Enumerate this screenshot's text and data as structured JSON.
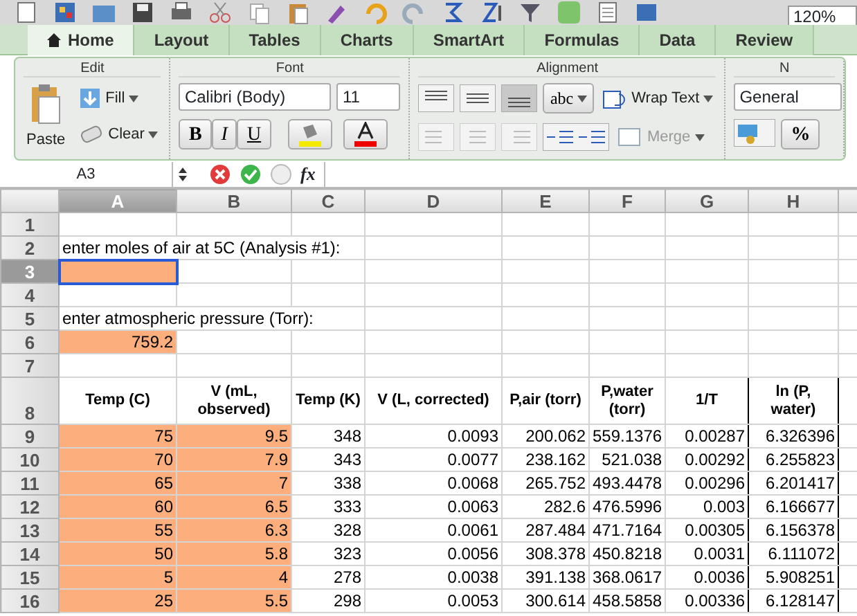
{
  "toolbar": {
    "zoom": "120%"
  },
  "tabs": [
    {
      "label": "Home",
      "selected": true
    },
    {
      "label": "Layout",
      "selected": false
    },
    {
      "label": "Tables",
      "selected": false
    },
    {
      "label": "Charts",
      "selected": false
    },
    {
      "label": "SmartArt",
      "selected": false
    },
    {
      "label": "Formulas",
      "selected": false
    },
    {
      "label": "Data",
      "selected": false
    },
    {
      "label": "Review",
      "selected": false
    }
  ],
  "ribbon": {
    "edit": {
      "title": "Edit",
      "paste": "Paste",
      "fill": "Fill",
      "clear": "Clear"
    },
    "font": {
      "title": "Font",
      "name": "Calibri (Body)",
      "size": "11",
      "bold": "B",
      "italic": "I",
      "underline": "U"
    },
    "alignment": {
      "title": "Alignment",
      "orientation": "abc",
      "wrap": "Wrap Text",
      "merge": "Merge",
      "merge_disabled": true
    },
    "number": {
      "title": "N",
      "format": "General",
      "percent": "%"
    }
  },
  "formula_bar": {
    "name_box": "A3",
    "fx": "fx"
  },
  "columns": [
    {
      "label": "A",
      "selected": true
    },
    {
      "label": "B",
      "selected": false
    },
    {
      "label": "C",
      "selected": false
    },
    {
      "label": "D",
      "selected": false
    },
    {
      "label": "E",
      "selected": false
    },
    {
      "label": "F",
      "selected": false
    },
    {
      "label": "G",
      "selected": false
    },
    {
      "label": "H",
      "selected": false
    }
  ],
  "rows": [
    {
      "number": "1",
      "selected": false,
      "cells": [
        {},
        {},
        {},
        {},
        {},
        {},
        {},
        {}
      ]
    },
    {
      "number": "2",
      "selected": false,
      "cells": [
        {
          "kind": "label",
          "text": "enter moles of air at 5C (Analysis #1):"
        },
        {},
        {},
        {},
        {},
        {},
        {},
        {}
      ]
    },
    {
      "number": "3",
      "selected": true,
      "cells": [
        {
          "input": true,
          "active": true
        },
        {},
        {},
        {},
        {},
        {},
        {},
        {}
      ]
    },
    {
      "number": "4",
      "selected": false,
      "cells": [
        {},
        {},
        {},
        {},
        {},
        {},
        {},
        {}
      ]
    },
    {
      "number": "5",
      "selected": false,
      "cells": [
        {
          "kind": "label",
          "text": "enter atmospheric pressure (Torr):"
        },
        {},
        {},
        {},
        {},
        {},
        {},
        {}
      ]
    },
    {
      "number": "6",
      "selected": false,
      "cells": [
        {
          "kind": "number",
          "text": "759.2",
          "input": true
        },
        {},
        {},
        {},
        {},
        {},
        {},
        {}
      ]
    },
    {
      "number": "7",
      "selected": false,
      "cells": [
        {},
        {},
        {},
        {},
        {},
        {},
        {},
        {}
      ]
    },
    {
      "number": "8",
      "selected": false,
      "cells": [
        {
          "kind": "header",
          "text": "Temp (C)"
        },
        {
          "kind": "header",
          "text": "V (mL, observed)"
        },
        {
          "kind": "header",
          "text": "Temp (K)"
        },
        {
          "kind": "header",
          "text": "V (L, corrected)"
        },
        {
          "kind": "header",
          "text": "P,air (torr)"
        },
        {
          "kind": "header",
          "text": "P,water (torr)"
        },
        {
          "kind": "header",
          "text": "1/T",
          "bordered": true
        },
        {
          "kind": "header",
          "text": "ln (P, water)",
          "bordered": true
        }
      ]
    },
    {
      "number": "9",
      "selected": false,
      "cells": [
        {
          "kind": "number",
          "text": "75",
          "input": true
        },
        {
          "kind": "number",
          "text": "9.5",
          "input": true
        },
        {
          "kind": "number",
          "text": "348"
        },
        {
          "kind": "number",
          "text": "0.0093"
        },
        {
          "kind": "number",
          "text": "200.062"
        },
        {
          "kind": "number",
          "text": "559.1376"
        },
        {
          "kind": "number",
          "text": "0.00287",
          "bordered": true
        },
        {
          "kind": "number",
          "text": "6.326396",
          "bordered": true
        }
      ]
    },
    {
      "number": "10",
      "selected": false,
      "cells": [
        {
          "kind": "number",
          "text": "70",
          "input": true
        },
        {
          "kind": "number",
          "text": "7.9",
          "input": true
        },
        {
          "kind": "number",
          "text": "343"
        },
        {
          "kind": "number",
          "text": "0.0077"
        },
        {
          "kind": "number",
          "text": "238.162"
        },
        {
          "kind": "number",
          "text": "521.038"
        },
        {
          "kind": "number",
          "text": "0.00292",
          "bordered": true
        },
        {
          "kind": "number",
          "text": "6.255823",
          "bordered": true
        }
      ]
    },
    {
      "number": "11",
      "selected": false,
      "cells": [
        {
          "kind": "number",
          "text": "65",
          "input": true
        },
        {
          "kind": "number",
          "text": "7",
          "input": true
        },
        {
          "kind": "number",
          "text": "338"
        },
        {
          "kind": "number",
          "text": "0.0068"
        },
        {
          "kind": "number",
          "text": "265.752"
        },
        {
          "kind": "number",
          "text": "493.4478"
        },
        {
          "kind": "number",
          "text": "0.00296",
          "bordered": true
        },
        {
          "kind": "number",
          "text": "6.201417",
          "bordered": true
        }
      ]
    },
    {
      "number": "12",
      "selected": false,
      "cells": [
        {
          "kind": "number",
          "text": "60",
          "input": true
        },
        {
          "kind": "number",
          "text": "6.5",
          "input": true
        },
        {
          "kind": "number",
          "text": "333"
        },
        {
          "kind": "number",
          "text": "0.0063"
        },
        {
          "kind": "number",
          "text": "282.6"
        },
        {
          "kind": "number",
          "text": "476.5996"
        },
        {
          "kind": "number",
          "text": "0.003",
          "bordered": true
        },
        {
          "kind": "number",
          "text": "6.166677",
          "bordered": true
        }
      ]
    },
    {
      "number": "13",
      "selected": false,
      "cells": [
        {
          "kind": "number",
          "text": "55",
          "input": true
        },
        {
          "kind": "number",
          "text": "6.3",
          "input": true
        },
        {
          "kind": "number",
          "text": "328"
        },
        {
          "kind": "number",
          "text": "0.0061"
        },
        {
          "kind": "number",
          "text": "287.484"
        },
        {
          "kind": "number",
          "text": "471.7164"
        },
        {
          "kind": "number",
          "text": "0.00305",
          "bordered": true
        },
        {
          "kind": "number",
          "text": "6.156378",
          "bordered": true
        }
      ]
    },
    {
      "number": "14",
      "selected": false,
      "cells": [
        {
          "kind": "number",
          "text": "50",
          "input": true
        },
        {
          "kind": "number",
          "text": "5.8",
          "input": true
        },
        {
          "kind": "number",
          "text": "323"
        },
        {
          "kind": "number",
          "text": "0.0056"
        },
        {
          "kind": "number",
          "text": "308.378"
        },
        {
          "kind": "number",
          "text": "450.8218"
        },
        {
          "kind": "number",
          "text": "0.0031",
          "bordered": true
        },
        {
          "kind": "number",
          "text": "6.111072",
          "bordered": true
        }
      ]
    },
    {
      "number": "15",
      "selected": false,
      "cells": [
        {
          "kind": "number",
          "text": "5",
          "input": true
        },
        {
          "kind": "number",
          "text": "4",
          "input": true
        },
        {
          "kind": "number",
          "text": "278"
        },
        {
          "kind": "number",
          "text": "0.0038"
        },
        {
          "kind": "number",
          "text": "391.138"
        },
        {
          "kind": "number",
          "text": "368.0617"
        },
        {
          "kind": "number",
          "text": "0.0036",
          "bordered": true
        },
        {
          "kind": "number",
          "text": "5.908251",
          "bordered": true
        }
      ]
    },
    {
      "number": "16",
      "selected": false,
      "cells": [
        {
          "kind": "number",
          "text": "25",
          "input": true
        },
        {
          "kind": "number",
          "text": "5.5",
          "input": true
        },
        {
          "kind": "number",
          "text": "298"
        },
        {
          "kind": "number",
          "text": "0.0053"
        },
        {
          "kind": "number",
          "text": "300.614"
        },
        {
          "kind": "number",
          "text": "458.5858"
        },
        {
          "kind": "number",
          "text": "0.00336",
          "bordered": true
        },
        {
          "kind": "number",
          "text": "6.128147",
          "bordered": true
        }
      ]
    }
  ]
}
